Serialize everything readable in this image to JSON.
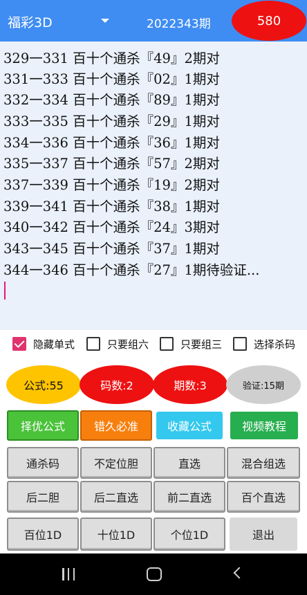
{
  "header": {
    "lottery_name": "福彩3D",
    "period": "2022343期",
    "count": "580"
  },
  "results": [
    "329一331  百十个通杀『49』2期对",
    "331一333  百十个通杀『02』1期对",
    "332一334  百十个通杀『89』1期对",
    "333一335  百十个通杀『29』1期对",
    "334一336  百十个通杀『36』1期对",
    "335一337  百十个通杀『57』2期对",
    "337一339  百十个通杀『19』2期对",
    "339一341  百十个通杀『38』1期对",
    "340一342  百十个通杀『24』3期对",
    "343一345  百十个通杀『37』1期对",
    "344一346  百十个通杀『27』1期待验证..."
  ],
  "options": [
    {
      "label": "隐藏单式",
      "checked": true
    },
    {
      "label": "只要组六",
      "checked": false
    },
    {
      "label": "只要组三",
      "checked": false
    },
    {
      "label": "选择杀码",
      "checked": false
    }
  ],
  "stats": {
    "formula": "公式:55",
    "codes": "码数:2",
    "periods": "期数:3",
    "verify": "验证:15期"
  },
  "actions": {
    "select_formula": "择优公式",
    "wrong_long": "错久必准",
    "fav_formula": "收藏公式",
    "video_tutorial": "视频教程"
  },
  "grid": [
    [
      "通杀码",
      "不定位胆",
      "直选",
      "混合组选"
    ],
    [
      "后二胆",
      "后二直选",
      "前二直选",
      "百个直选"
    ],
    [
      "百位1D",
      "十位1D",
      "个位1D",
      "退出"
    ]
  ],
  "colors": {
    "header": "#3f8df2",
    "red": "#ee1111",
    "yellow": "#ffc400",
    "result_bg": "#eaf1fb"
  }
}
